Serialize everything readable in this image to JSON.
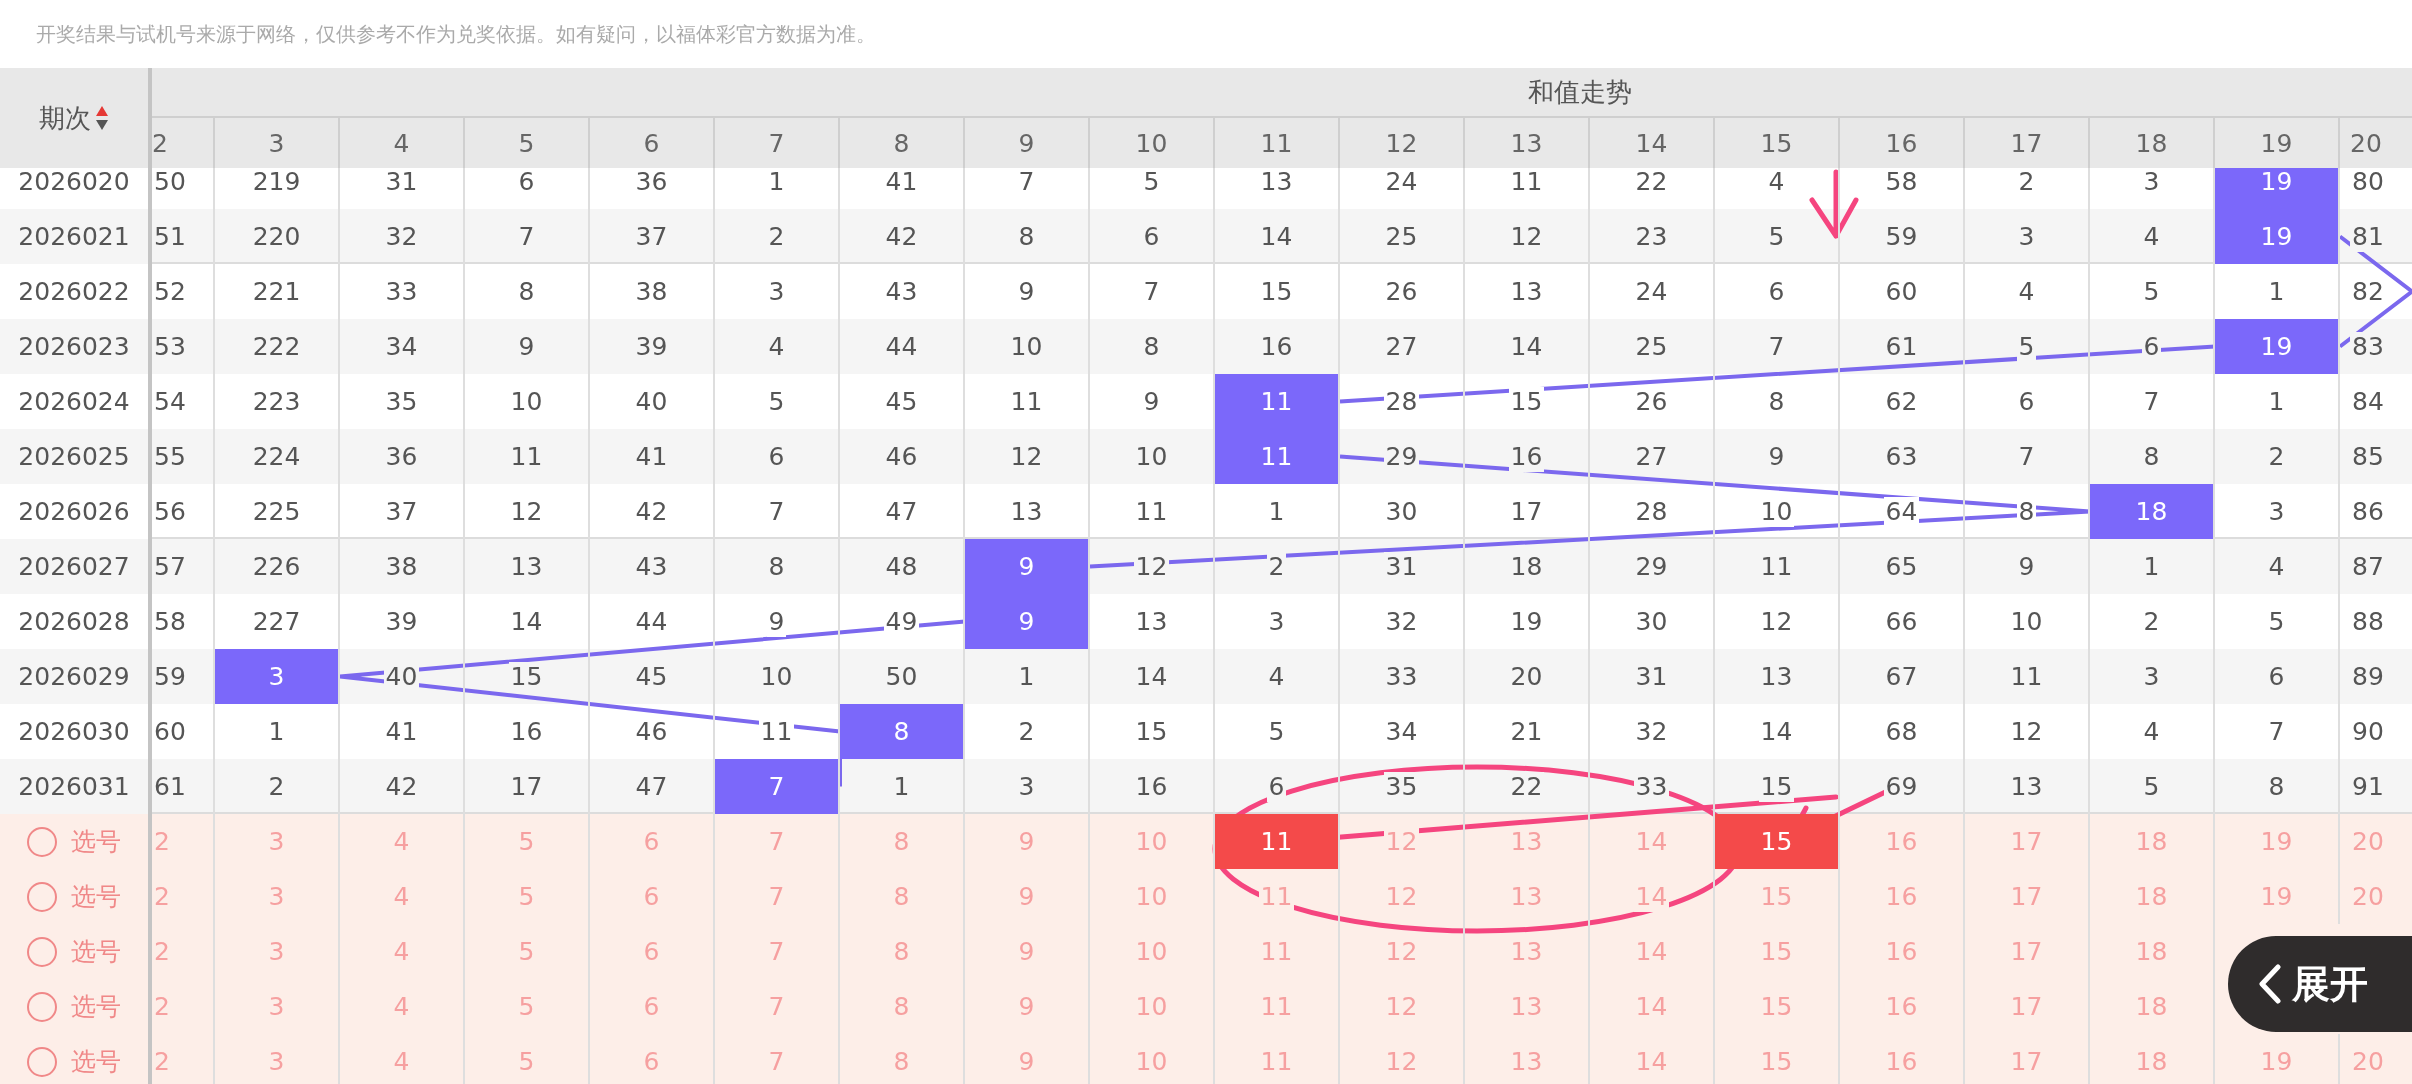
{
  "notice": "开奖结果与试机号来源于网络，仅供参考不作为兑奖依据。如有疑问，以福体彩官方数据为准。",
  "frozen_header": "期次",
  "group_header": "和值走势",
  "columns": [
    "2",
    "3",
    "4",
    "5",
    "6",
    "7",
    "8",
    "9",
    "10",
    "11",
    "12",
    "13",
    "14",
    "15",
    "16",
    "17",
    "18",
    "19",
    "20"
  ],
  "rows": [
    {
      "period": "2026020",
      "cells": [
        {
          "text": "50",
          "hit": false
        },
        {
          "text": "219",
          "hit": false
        },
        {
          "text": "31",
          "hit": false
        },
        {
          "text": "6",
          "hit": false
        },
        {
          "text": "36",
          "hit": false
        },
        {
          "text": "1",
          "hit": false
        },
        {
          "text": "41",
          "hit": false
        },
        {
          "text": "7",
          "hit": false
        },
        {
          "text": "5",
          "hit": false
        },
        {
          "text": "13",
          "hit": false
        },
        {
          "text": "24",
          "hit": false
        },
        {
          "text": "11",
          "hit": false
        },
        {
          "text": "22",
          "hit": false
        },
        {
          "text": "4",
          "hit": false
        },
        {
          "text": "58",
          "hit": false
        },
        {
          "text": "2",
          "hit": false
        },
        {
          "text": "3",
          "hit": false
        },
        {
          "text": "19",
          "hit": true
        },
        {
          "text": "80",
          "hit": false
        }
      ]
    },
    {
      "period": "2026021",
      "cells": [
        {
          "text": "51",
          "hit": false
        },
        {
          "text": "220",
          "hit": false
        },
        {
          "text": "32",
          "hit": false
        },
        {
          "text": "7",
          "hit": false
        },
        {
          "text": "37",
          "hit": false
        },
        {
          "text": "2",
          "hit": false
        },
        {
          "text": "42",
          "hit": false
        },
        {
          "text": "8",
          "hit": false
        },
        {
          "text": "6",
          "hit": false
        },
        {
          "text": "14",
          "hit": false
        },
        {
          "text": "25",
          "hit": false
        },
        {
          "text": "12",
          "hit": false
        },
        {
          "text": "23",
          "hit": false
        },
        {
          "text": "5",
          "hit": false
        },
        {
          "text": "59",
          "hit": false
        },
        {
          "text": "3",
          "hit": false
        },
        {
          "text": "4",
          "hit": false
        },
        {
          "text": "19",
          "hit": true
        },
        {
          "text": "81",
          "hit": false
        }
      ]
    },
    {
      "period": "2026022",
      "cells": [
        {
          "text": "52",
          "hit": false
        },
        {
          "text": "221",
          "hit": false
        },
        {
          "text": "33",
          "hit": false
        },
        {
          "text": "8",
          "hit": false
        },
        {
          "text": "38",
          "hit": false
        },
        {
          "text": "3",
          "hit": false
        },
        {
          "text": "43",
          "hit": false
        },
        {
          "text": "9",
          "hit": false
        },
        {
          "text": "7",
          "hit": false
        },
        {
          "text": "15",
          "hit": false
        },
        {
          "text": "26",
          "hit": false
        },
        {
          "text": "13",
          "hit": false
        },
        {
          "text": "24",
          "hit": false
        },
        {
          "text": "6",
          "hit": false
        },
        {
          "text": "60",
          "hit": false
        },
        {
          "text": "4",
          "hit": false
        },
        {
          "text": "5",
          "hit": false
        },
        {
          "text": "1",
          "hit": false
        },
        {
          "text": "82",
          "hit": false
        }
      ]
    },
    {
      "period": "2026023",
      "cells": [
        {
          "text": "53",
          "hit": false
        },
        {
          "text": "222",
          "hit": false
        },
        {
          "text": "34",
          "hit": false
        },
        {
          "text": "9",
          "hit": false
        },
        {
          "text": "39",
          "hit": false
        },
        {
          "text": "4",
          "hit": false
        },
        {
          "text": "44",
          "hit": false
        },
        {
          "text": "10",
          "hit": false
        },
        {
          "text": "8",
          "hit": false
        },
        {
          "text": "16",
          "hit": false
        },
        {
          "text": "27",
          "hit": false
        },
        {
          "text": "14",
          "hit": false
        },
        {
          "text": "25",
          "hit": false
        },
        {
          "text": "7",
          "hit": false
        },
        {
          "text": "61",
          "hit": false
        },
        {
          "text": "5",
          "hit": false
        },
        {
          "text": "6",
          "hit": false
        },
        {
          "text": "19",
          "hit": true
        },
        {
          "text": "83",
          "hit": false
        }
      ]
    },
    {
      "period": "2026024",
      "cells": [
        {
          "text": "54",
          "hit": false
        },
        {
          "text": "223",
          "hit": false
        },
        {
          "text": "35",
          "hit": false
        },
        {
          "text": "10",
          "hit": false
        },
        {
          "text": "40",
          "hit": false
        },
        {
          "text": "5",
          "hit": false
        },
        {
          "text": "45",
          "hit": false
        },
        {
          "text": "11",
          "hit": false
        },
        {
          "text": "9",
          "hit": false
        },
        {
          "text": "11",
          "hit": true
        },
        {
          "text": "28",
          "hit": false
        },
        {
          "text": "15",
          "hit": false
        },
        {
          "text": "26",
          "hit": false
        },
        {
          "text": "8",
          "hit": false
        },
        {
          "text": "62",
          "hit": false
        },
        {
          "text": "6",
          "hit": false
        },
        {
          "text": "7",
          "hit": false
        },
        {
          "text": "1",
          "hit": false
        },
        {
          "text": "84",
          "hit": false
        }
      ]
    },
    {
      "period": "2026025",
      "cells": [
        {
          "text": "55",
          "hit": false
        },
        {
          "text": "224",
          "hit": false
        },
        {
          "text": "36",
          "hit": false
        },
        {
          "text": "11",
          "hit": false
        },
        {
          "text": "41",
          "hit": false
        },
        {
          "text": "6",
          "hit": false
        },
        {
          "text": "46",
          "hit": false
        },
        {
          "text": "12",
          "hit": false
        },
        {
          "text": "10",
          "hit": false
        },
        {
          "text": "11",
          "hit": true
        },
        {
          "text": "29",
          "hit": false
        },
        {
          "text": "16",
          "hit": false
        },
        {
          "text": "27",
          "hit": false
        },
        {
          "text": "9",
          "hit": false
        },
        {
          "text": "63",
          "hit": false
        },
        {
          "text": "7",
          "hit": false
        },
        {
          "text": "8",
          "hit": false
        },
        {
          "text": "2",
          "hit": false
        },
        {
          "text": "85",
          "hit": false
        }
      ]
    },
    {
      "period": "2026026",
      "cells": [
        {
          "text": "56",
          "hit": false
        },
        {
          "text": "225",
          "hit": false
        },
        {
          "text": "37",
          "hit": false
        },
        {
          "text": "12",
          "hit": false
        },
        {
          "text": "42",
          "hit": false
        },
        {
          "text": "7",
          "hit": false
        },
        {
          "text": "47",
          "hit": false
        },
        {
          "text": "13",
          "hit": false
        },
        {
          "text": "11",
          "hit": false
        },
        {
          "text": "1",
          "hit": false
        },
        {
          "text": "30",
          "hit": false
        },
        {
          "text": "17",
          "hit": false
        },
        {
          "text": "28",
          "hit": false
        },
        {
          "text": "10",
          "hit": false
        },
        {
          "text": "64",
          "hit": false
        },
        {
          "text": "8",
          "hit": false
        },
        {
          "text": "18",
          "hit": true
        },
        {
          "text": "3",
          "hit": false
        },
        {
          "text": "86",
          "hit": false
        }
      ]
    },
    {
      "period": "2026027",
      "cells": [
        {
          "text": "57",
          "hit": false
        },
        {
          "text": "226",
          "hit": false
        },
        {
          "text": "38",
          "hit": false
        },
        {
          "text": "13",
          "hit": false
        },
        {
          "text": "43",
          "hit": false
        },
        {
          "text": "8",
          "hit": false
        },
        {
          "text": "48",
          "hit": false
        },
        {
          "text": "9",
          "hit": true
        },
        {
          "text": "12",
          "hit": false
        },
        {
          "text": "2",
          "hit": false
        },
        {
          "text": "31",
          "hit": false
        },
        {
          "text": "18",
          "hit": false
        },
        {
          "text": "29",
          "hit": false
        },
        {
          "text": "11",
          "hit": false
        },
        {
          "text": "65",
          "hit": false
        },
        {
          "text": "9",
          "hit": false
        },
        {
          "text": "1",
          "hit": false
        },
        {
          "text": "4",
          "hit": false
        },
        {
          "text": "87",
          "hit": false
        }
      ]
    },
    {
      "period": "2026028",
      "cells": [
        {
          "text": "58",
          "hit": false
        },
        {
          "text": "227",
          "hit": false
        },
        {
          "text": "39",
          "hit": false
        },
        {
          "text": "14",
          "hit": false
        },
        {
          "text": "44",
          "hit": false
        },
        {
          "text": "9",
          "hit": false
        },
        {
          "text": "49",
          "hit": false
        },
        {
          "text": "9",
          "hit": true
        },
        {
          "text": "13",
          "hit": false
        },
        {
          "text": "3",
          "hit": false
        },
        {
          "text": "32",
          "hit": false
        },
        {
          "text": "19",
          "hit": false
        },
        {
          "text": "30",
          "hit": false
        },
        {
          "text": "12",
          "hit": false
        },
        {
          "text": "66",
          "hit": false
        },
        {
          "text": "10",
          "hit": false
        },
        {
          "text": "2",
          "hit": false
        },
        {
          "text": "5",
          "hit": false
        },
        {
          "text": "88",
          "hit": false
        }
      ]
    },
    {
      "period": "2026029",
      "cells": [
        {
          "text": "59",
          "hit": false
        },
        {
          "text": "3",
          "hit": true
        },
        {
          "text": "40",
          "hit": false
        },
        {
          "text": "15",
          "hit": false
        },
        {
          "text": "45",
          "hit": false
        },
        {
          "text": "10",
          "hit": false
        },
        {
          "text": "50",
          "hit": false
        },
        {
          "text": "1",
          "hit": false
        },
        {
          "text": "14",
          "hit": false
        },
        {
          "text": "4",
          "hit": false
        },
        {
          "text": "33",
          "hit": false
        },
        {
          "text": "20",
          "hit": false
        },
        {
          "text": "31",
          "hit": false
        },
        {
          "text": "13",
          "hit": false
        },
        {
          "text": "67",
          "hit": false
        },
        {
          "text": "11",
          "hit": false
        },
        {
          "text": "3",
          "hit": false
        },
        {
          "text": "6",
          "hit": false
        },
        {
          "text": "89",
          "hit": false
        }
      ]
    },
    {
      "period": "2026030",
      "cells": [
        {
          "text": "60",
          "hit": false
        },
        {
          "text": "1",
          "hit": false
        },
        {
          "text": "41",
          "hit": false
        },
        {
          "text": "16",
          "hit": false
        },
        {
          "text": "46",
          "hit": false
        },
        {
          "text": "11",
          "hit": false
        },
        {
          "text": "8",
          "hit": true
        },
        {
          "text": "2",
          "hit": false
        },
        {
          "text": "15",
          "hit": false
        },
        {
          "text": "5",
          "hit": false
        },
        {
          "text": "34",
          "hit": false
        },
        {
          "text": "21",
          "hit": false
        },
        {
          "text": "32",
          "hit": false
        },
        {
          "text": "14",
          "hit": false
        },
        {
          "text": "68",
          "hit": false
        },
        {
          "text": "12",
          "hit": false
        },
        {
          "text": "4",
          "hit": false
        },
        {
          "text": "7",
          "hit": false
        },
        {
          "text": "90",
          "hit": false
        }
      ]
    },
    {
      "period": "2026031",
      "cells": [
        {
          "text": "61",
          "hit": false
        },
        {
          "text": "2",
          "hit": false
        },
        {
          "text": "42",
          "hit": false
        },
        {
          "text": "17",
          "hit": false
        },
        {
          "text": "47",
          "hit": false
        },
        {
          "text": "7",
          "hit": true
        },
        {
          "text": "1",
          "hit": false
        },
        {
          "text": "3",
          "hit": false
        },
        {
          "text": "16",
          "hit": false
        },
        {
          "text": "6",
          "hit": false
        },
        {
          "text": "35",
          "hit": false
        },
        {
          "text": "22",
          "hit": false
        },
        {
          "text": "33",
          "hit": false
        },
        {
          "text": "15",
          "hit": false
        },
        {
          "text": "69",
          "hit": false
        },
        {
          "text": "13",
          "hit": false
        },
        {
          "text": "5",
          "hit": false
        },
        {
          "text": "8",
          "hit": false
        },
        {
          "text": "91",
          "hit": false
        }
      ]
    }
  ],
  "pick_rows": [
    {
      "label": "选号",
      "checked": false,
      "cells": [
        {
          "text": "2",
          "selected": false
        },
        {
          "text": "3",
          "selected": false
        },
        {
          "text": "4",
          "selected": false
        },
        {
          "text": "5",
          "selected": false
        },
        {
          "text": "6",
          "selected": false
        },
        {
          "text": "7",
          "selected": false
        },
        {
          "text": "8",
          "selected": false
        },
        {
          "text": "9",
          "selected": false
        },
        {
          "text": "10",
          "selected": false
        },
        {
          "text": "11",
          "selected": true
        },
        {
          "text": "12",
          "selected": false
        },
        {
          "text": "13",
          "selected": false
        },
        {
          "text": "14",
          "selected": false
        },
        {
          "text": "15",
          "selected": true
        },
        {
          "text": "16",
          "selected": false
        },
        {
          "text": "17",
          "selected": false
        },
        {
          "text": "18",
          "selected": false
        },
        {
          "text": "19",
          "selected": false
        },
        {
          "text": "20",
          "selected": false
        }
      ]
    },
    {
      "label": "选号",
      "checked": false,
      "cells": [
        {
          "text": "2",
          "selected": false
        },
        {
          "text": "3",
          "selected": false
        },
        {
          "text": "4",
          "selected": false
        },
        {
          "text": "5",
          "selected": false
        },
        {
          "text": "6",
          "selected": false
        },
        {
          "text": "7",
          "selected": false
        },
        {
          "text": "8",
          "selected": false
        },
        {
          "text": "9",
          "selected": false
        },
        {
          "text": "10",
          "selected": false
        },
        {
          "text": "11",
          "selected": false
        },
        {
          "text": "12",
          "selected": false
        },
        {
          "text": "13",
          "selected": false
        },
        {
          "text": "14",
          "selected": false
        },
        {
          "text": "15",
          "selected": false
        },
        {
          "text": "16",
          "selected": false
        },
        {
          "text": "17",
          "selected": false
        },
        {
          "text": "18",
          "selected": false
        },
        {
          "text": "19",
          "selected": false
        },
        {
          "text": "20",
          "selected": false
        }
      ]
    },
    {
      "label": "选号",
      "checked": false,
      "cells": [
        {
          "text": "2",
          "selected": false
        },
        {
          "text": "3",
          "selected": false
        },
        {
          "text": "4",
          "selected": false
        },
        {
          "text": "5",
          "selected": false
        },
        {
          "text": "6",
          "selected": false
        },
        {
          "text": "7",
          "selected": false
        },
        {
          "text": "8",
          "selected": false
        },
        {
          "text": "9",
          "selected": false
        },
        {
          "text": "10",
          "selected": false
        },
        {
          "text": "11",
          "selected": false
        },
        {
          "text": "12",
          "selected": false
        },
        {
          "text": "13",
          "selected": false
        },
        {
          "text": "14",
          "selected": false
        },
        {
          "text": "15",
          "selected": false
        },
        {
          "text": "16",
          "selected": false
        },
        {
          "text": "17",
          "selected": false
        },
        {
          "text": "18",
          "selected": false
        }
      ]
    },
    {
      "label": "选号",
      "checked": false,
      "cells": [
        {
          "text": "2",
          "selected": false
        },
        {
          "text": "3",
          "selected": false
        },
        {
          "text": "4",
          "selected": false
        },
        {
          "text": "5",
          "selected": false
        },
        {
          "text": "6",
          "selected": false
        },
        {
          "text": "7",
          "selected": false
        },
        {
          "text": "8",
          "selected": false
        },
        {
          "text": "9",
          "selected": false
        },
        {
          "text": "10",
          "selected": false
        },
        {
          "text": "11",
          "selected": false
        },
        {
          "text": "12",
          "selected": false
        },
        {
          "text": "13",
          "selected": false
        },
        {
          "text": "14",
          "selected": false
        },
        {
          "text": "15",
          "selected": false
        },
        {
          "text": "16",
          "selected": false
        },
        {
          "text": "17",
          "selected": false
        },
        {
          "text": "18",
          "selected": false
        }
      ]
    },
    {
      "label": "选号",
      "checked": false,
      "cells": [
        {
          "text": "2",
          "selected": false
        },
        {
          "text": "3",
          "selected": false
        },
        {
          "text": "4",
          "selected": false
        },
        {
          "text": "5",
          "selected": false
        },
        {
          "text": "6",
          "selected": false
        },
        {
          "text": "7",
          "selected": false
        },
        {
          "text": "8",
          "selected": false
        },
        {
          "text": "9",
          "selected": false
        },
        {
          "text": "10",
          "selected": false
        },
        {
          "text": "11",
          "selected": false
        },
        {
          "text": "12",
          "selected": false
        },
        {
          "text": "13",
          "selected": false
        },
        {
          "text": "14",
          "selected": false
        },
        {
          "text": "15",
          "selected": false
        },
        {
          "text": "16",
          "selected": false
        },
        {
          "text": "17",
          "selected": false
        },
        {
          "text": "18",
          "selected": false
        },
        {
          "text": "19",
          "selected": false
        },
        {
          "text": "20",
          "selected": false
        }
      ]
    }
  ],
  "expand_button": "展开"
}
